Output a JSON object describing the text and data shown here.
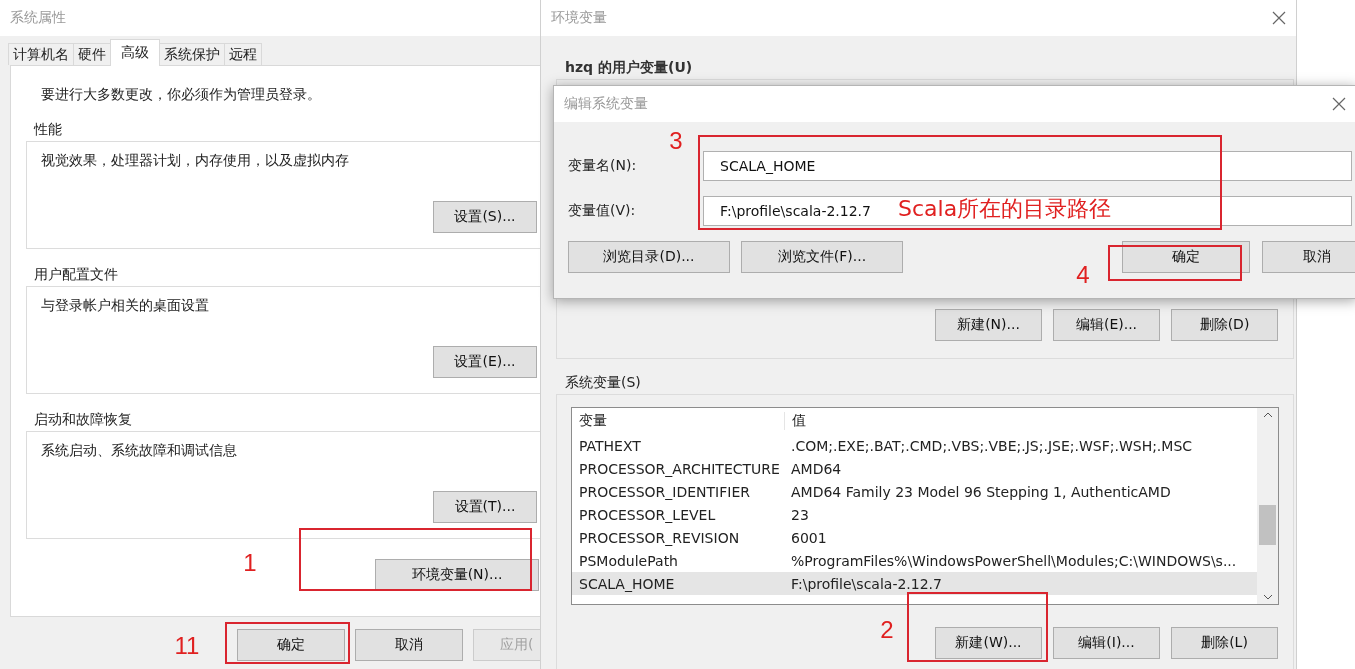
{
  "system_properties": {
    "title": "系统属性",
    "tabs": [
      {
        "label": "计算机名",
        "selected": false
      },
      {
        "label": "硬件",
        "selected": false
      },
      {
        "label": "高级",
        "selected": true
      },
      {
        "label": "系统保护",
        "selected": false
      },
      {
        "label": "远程",
        "selected": false
      }
    ],
    "notice": "要进行大多数更改，你必须作为管理员登录。",
    "groups": [
      {
        "title": "性能",
        "description": "视觉效果，处理器计划，内存使用，以及虚拟内存",
        "button": "设置(S)..."
      },
      {
        "title": "用户配置文件",
        "description": "与登录帐户相关的桌面设置",
        "button": "设置(E)..."
      },
      {
        "title": "启动和故障恢复",
        "description": "系统启动、系统故障和调试信息",
        "button": "设置(T)..."
      }
    ],
    "env_button": "环境变量(N)...",
    "buttons": [
      {
        "label": "确定",
        "disabled": false
      },
      {
        "label": "取消",
        "disabled": false
      },
      {
        "label": "应用(",
        "disabled": true
      }
    ]
  },
  "environment_variables": {
    "title": "环境变量",
    "user_group": {
      "title": "hzq 的用户变量(U)",
      "buttons": [
        "新建(N)...",
        "编辑(E)...",
        "删除(D)"
      ]
    },
    "system_group": {
      "title": "系统变量(S)",
      "columns": [
        "变量",
        "值"
      ],
      "rows": [
        {
          "name": "PATHEXT",
          "value": ".COM;.EXE;.BAT;.CMD;.VBS;.VBE;.JS;.JSE;.WSF;.WSH;.MSC",
          "selected": false
        },
        {
          "name": "PROCESSOR_ARCHITECTURE",
          "value": "AMD64",
          "selected": false
        },
        {
          "name": "PROCESSOR_IDENTIFIER",
          "value": "AMD64 Family 23 Model 96 Stepping 1, AuthenticAMD",
          "selected": false
        },
        {
          "name": "PROCESSOR_LEVEL",
          "value": "23",
          "selected": false
        },
        {
          "name": "PROCESSOR_REVISION",
          "value": "6001",
          "selected": false
        },
        {
          "name": "PSModulePath",
          "value": "%ProgramFiles%\\WindowsPowerShell\\Modules;C:\\WINDOWS\\s...",
          "selected": false
        },
        {
          "name": "SCALA_HOME",
          "value": "F:\\profile\\scala-2.12.7",
          "selected": true
        }
      ],
      "buttons": [
        "新建(W)...",
        "编辑(I)...",
        "删除(L)"
      ]
    }
  },
  "edit_dialog": {
    "title": "编辑系统变量",
    "fields": [
      {
        "label": "变量名(N):",
        "value": "SCALA_HOME"
      },
      {
        "label": "变量值(V):",
        "value": "F:\\profile\\scala-2.12.7"
      }
    ],
    "buttons": [
      "浏览目录(D)...",
      "浏览文件(F)...",
      "确定",
      "取消"
    ]
  },
  "annotations": [
    {
      "number": "1"
    },
    {
      "number": "2"
    },
    {
      "number": "3"
    },
    {
      "number": "4"
    },
    {
      "number": "11"
    }
  ],
  "note": "Scala所在的目录路径"
}
